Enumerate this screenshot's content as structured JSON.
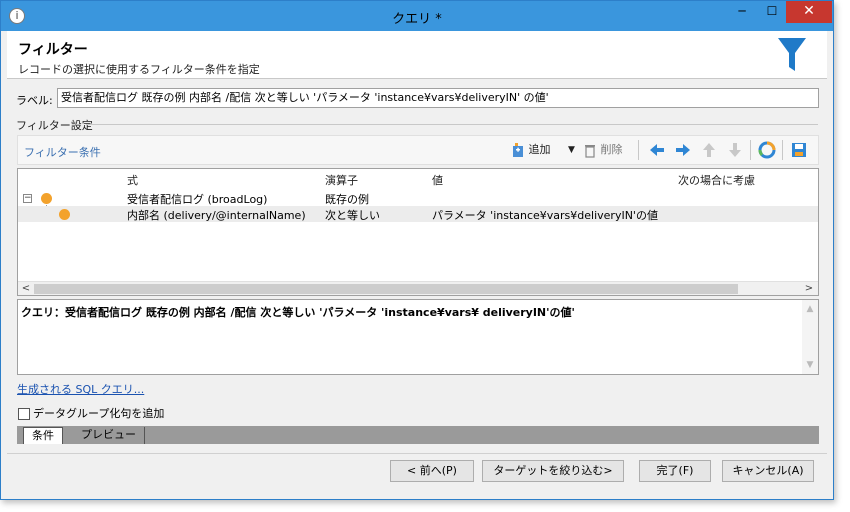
{
  "window": {
    "title": "クエリ *",
    "minimize": "─",
    "maximize": "☐",
    "close": "✕",
    "app_icon": "i"
  },
  "header": {
    "title": "フィルター",
    "subtitle": "レコードの選択に使用するフィルター条件を指定"
  },
  "label_field": {
    "label": "ラベル:",
    "value": "受信者配信ログ 既存の例 内部名 /配信 次と等しい 'パラメータ 'instance¥vars¥deliveryIN' の値'"
  },
  "filter_settings": {
    "label": "フィルター設定"
  },
  "toolbar": {
    "conditions_label": "フィルター条件",
    "add_label": "追加",
    "delete_label": "削除"
  },
  "grid": {
    "columns": [
      "式",
      "演算子",
      "値",
      "次の場合に考慮"
    ],
    "rows": [
      {
        "expression": "受信者配信ログ (broadLog)",
        "operator": "既存の例",
        "value": "",
        "consider": ""
      },
      {
        "expression": "内部名 (delivery/@internalName)",
        "operator": "次と等しい",
        "value": "パラメータ 'instance¥vars¥deliveryIN'の値",
        "consider": ""
      }
    ],
    "expander": "−"
  },
  "query": {
    "text": "クエリ：受信者配信ログ 既存の例 内部名 /配信 次と等しい 'パラメータ 'instance¥vars¥ deliveryIN'の値'"
  },
  "sql_link": "生成される SQL クエリ...",
  "checkbox": {
    "label": "データグループ化句を追加",
    "checked": false
  },
  "tabs": [
    {
      "label": "条件"
    },
    {
      "label": "プレビュー"
    }
  ],
  "buttons": {
    "previous": "< 前へ(P)",
    "narrow_target": "ターゲットを絞り込む>",
    "finish": "完了(F)",
    "cancel": "キャンセル(A)"
  },
  "colors": {
    "accent": "#3a96dd",
    "funnel": "#1f7ac8",
    "dot": "#f3a22c",
    "link": "#1a52b0"
  }
}
